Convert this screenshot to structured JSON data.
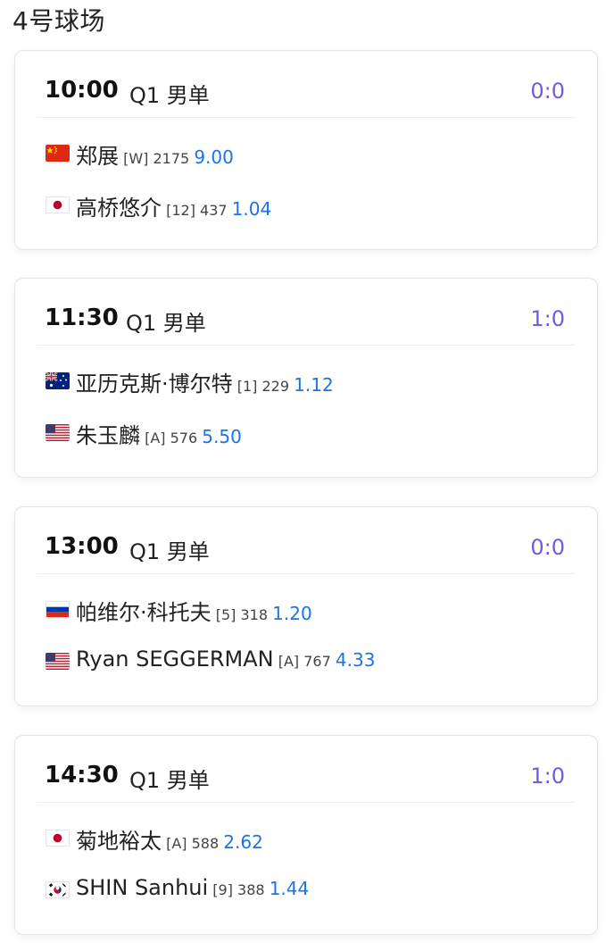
{
  "court_title": "4号球场",
  "matches": [
    {
      "time": "10:00",
      "event": "Q1 男单",
      "score": "0:0",
      "players": [
        {
          "flag": "cn",
          "name": "郑展",
          "seed": "[W]",
          "rank": "2175",
          "odds": "9.00"
        },
        {
          "flag": "jp",
          "name": "高桥悠介",
          "seed": "[12]",
          "rank": "437",
          "odds": "1.04"
        }
      ]
    },
    {
      "time": "11:30",
      "event": "Q1 男单",
      "score": "1:0",
      "players": [
        {
          "flag": "au",
          "name": "亚历克斯·博尔特",
          "seed": "[1]",
          "rank": "229",
          "odds": "1.12"
        },
        {
          "flag": "us",
          "name": "朱玉麟",
          "seed": "[A]",
          "rank": "576",
          "odds": "5.50"
        }
      ]
    },
    {
      "time": "13:00",
      "event": "Q1 男单",
      "score": "0:0",
      "players": [
        {
          "flag": "ru",
          "name": "帕维尔·科托夫",
          "seed": "[5]",
          "rank": "318",
          "odds": "1.20"
        },
        {
          "flag": "us",
          "name": "Ryan SEGGERMAN",
          "seed": "[A]",
          "rank": "767",
          "odds": "4.33"
        }
      ]
    },
    {
      "time": "14:30",
      "event": "Q1 男单",
      "score": "1:0",
      "players": [
        {
          "flag": "jp",
          "name": "菊地裕太",
          "seed": "[A]",
          "rank": "588",
          "odds": "2.62"
        },
        {
          "flag": "kr",
          "name": "SHIN Sanhui",
          "seed": "[9]",
          "rank": "388",
          "odds": "1.44"
        }
      ]
    }
  ],
  "colors": {
    "score": "#6c5ce7",
    "odds": "#1a73e8",
    "card_border": "#dfe3ea"
  },
  "icons": {
    "cn": "china-flag-icon",
    "jp": "japan-flag-icon",
    "au": "australia-flag-icon",
    "us": "usa-flag-icon",
    "ru": "russia-flag-icon",
    "kr": "south-korea-flag-icon"
  }
}
